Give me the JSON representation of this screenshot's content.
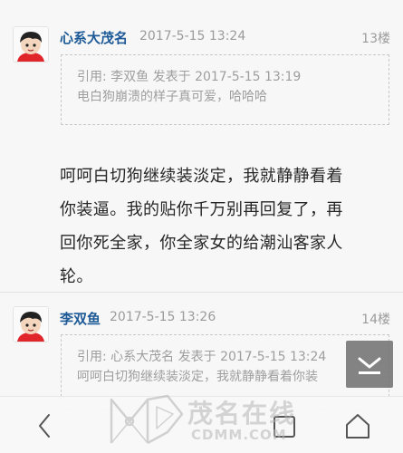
{
  "posts": [
    {
      "author": "心系大茂名",
      "time": "2017-5-15 13:24",
      "floor": "13楼",
      "quote": {
        "header": "引用: 李双鱼 发表于 2017-5-15 13:19",
        "text": "电白狗崩溃的样子真可爱，哈哈哈"
      },
      "body_lines": [
        "呵呵白切狗继续装淡定，我就静静看着",
        "你装逼。我的贴你千万别再回复了，再",
        "回你死全家，你全家女的给潮汕客家人",
        "轮。"
      ]
    },
    {
      "author": "李双鱼",
      "time": "2017-5-15 13:26",
      "floor": "14楼",
      "quote": {
        "header": "引用: 心系大茂名 发表于 2017-5-15 13:24",
        "text": "呵呵白切狗继续装淡定，我就静静看着你装"
      }
    }
  ],
  "scroll_button": {
    "icon": "scroll-to-bottom-icon"
  },
  "navbar": {
    "back_icon": "back-chevron-icon",
    "recent_icon": "recent-apps-icon",
    "home_icon": "home-icon"
  },
  "watermark": {
    "text": "茂名在线",
    "url": "CDMM.COM"
  },
  "colors": {
    "author": "#1d5a97",
    "meta": "#9b9b9b",
    "body": "#262626",
    "background": "#f7f7f7"
  }
}
